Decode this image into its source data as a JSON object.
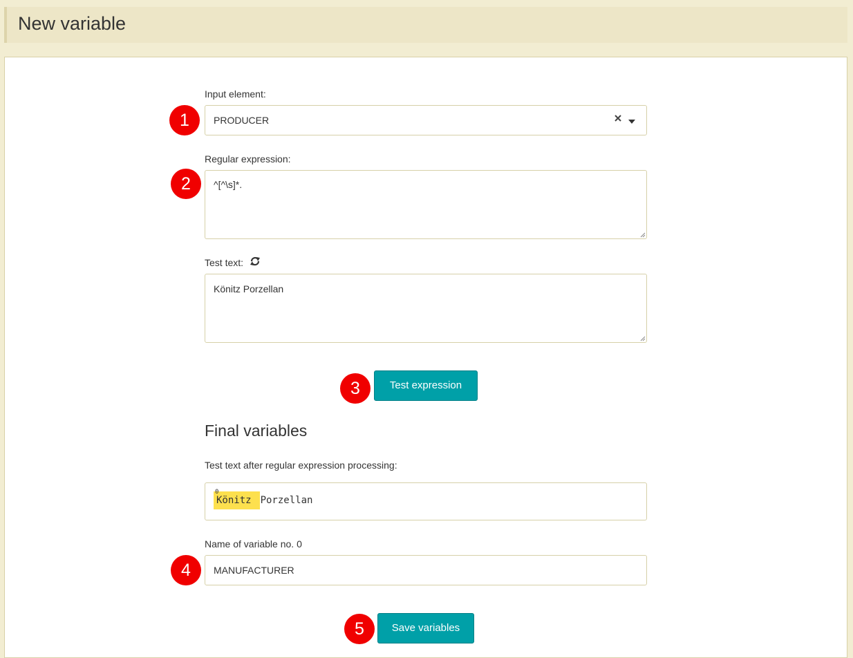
{
  "header": {
    "title": "New variable"
  },
  "form": {
    "input_element": {
      "label": "Input element:",
      "value": "PRODUCER"
    },
    "regex": {
      "label": "Regular expression:",
      "value": "^[^\\s]*."
    },
    "test_text": {
      "label": "Test text:",
      "value": "Könitz Porzellan"
    },
    "test_button_label": "Test expression"
  },
  "final": {
    "title": "Final variables",
    "processed_label": "Test text after regular expression processing:",
    "match_marker": "0",
    "match_text": "Könitz",
    "rest_text": "Porzellan",
    "variable_name_label": "Name of variable no. 0",
    "variable_name_value": "MANUFACTURER",
    "save_button_label": "Save variables"
  },
  "markers": [
    "1",
    "2",
    "3",
    "4",
    "5"
  ],
  "colors": {
    "accent": "#00a0a8",
    "marker": "#f00000",
    "highlight": "#fde04e",
    "background": "#f2edd2"
  }
}
